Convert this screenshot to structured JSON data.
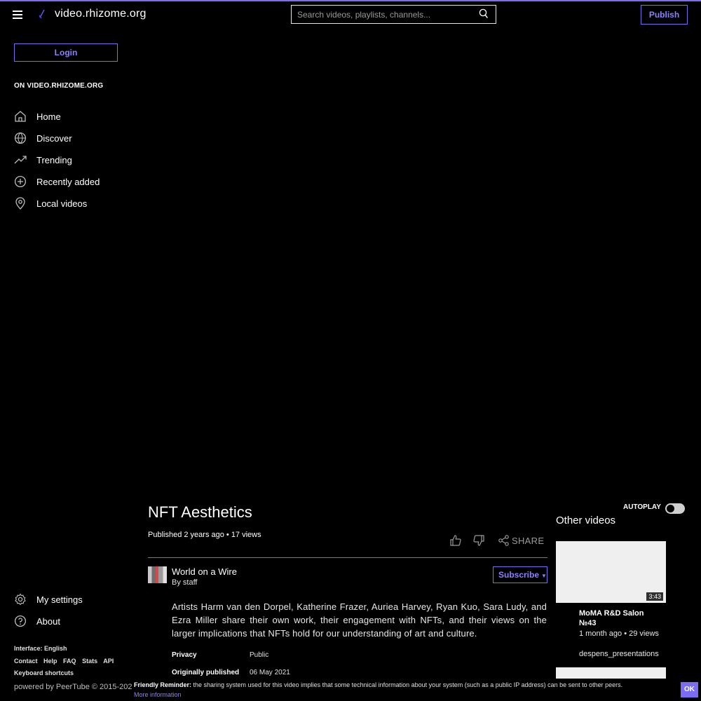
{
  "header": {
    "site_name": "video.rhizome.org",
    "search_placeholder": "Search videos, playlists, channels...",
    "publish_label": "Publish"
  },
  "sidebar": {
    "login_label": "Login",
    "section_title": "ON VIDEO.RHIZOME.ORG",
    "items": [
      {
        "label": "Home",
        "icon": "home-icon"
      },
      {
        "label": "Discover",
        "icon": "globe-icon"
      },
      {
        "label": "Trending",
        "icon": "trending-icon"
      },
      {
        "label": "Recently added",
        "icon": "plus-circle-icon"
      },
      {
        "label": "Local videos",
        "icon": "map-pin-icon"
      }
    ],
    "bottom_items": [
      {
        "label": "My settings",
        "icon": "gear-icon"
      },
      {
        "label": "About",
        "icon": "help-icon"
      }
    ],
    "interface_language": "Interface: English",
    "footer_links": [
      "Contact",
      "Help",
      "FAQ",
      "Stats",
      "API"
    ],
    "keyboard_shortcuts": "Keyboard shortcuts",
    "powered_by": "powered by PeerTube © 2015-202"
  },
  "video": {
    "title": "NFT Aesthetics",
    "published": "Published 2 years ago • 17 views",
    "share_label": "SHARE",
    "channel_name": "World on a Wire",
    "channel_by": "By staff",
    "subscribe_label": "Subscribe",
    "description": "Artists Harm van den Dorpel, Katherine Frazer, Auriea Harvey, Ryan Kuo, Sara Ludy, and Ezra Miller share their own work, their engagement with NFTs, and their views on the larger implications that NFTs hold for our understanding of art and culture.",
    "attributes": [
      {
        "label": "Privacy",
        "value": "Public"
      },
      {
        "label": "Originally published",
        "value": "06 May 2021"
      }
    ]
  },
  "recommendations": {
    "autoplay_label": "AUTOPLAY",
    "autoplay_on": false,
    "heading": "Other videos",
    "items": [
      {
        "title": "MoMA R&D Salon №43",
        "meta": "1 month ago • 29 views",
        "channel": "despens_presentations",
        "duration": "3:43"
      }
    ]
  },
  "cookie_banner": {
    "bold": "Friendly Reminder:",
    "text": " the sharing system used for this video implies that some technical information about your system (such as a public IP address) can be sent to other peers.",
    "more": "More information",
    "ok": "OK"
  },
  "colors": {
    "accent": "#7b6cf2",
    "background": "#000000"
  }
}
